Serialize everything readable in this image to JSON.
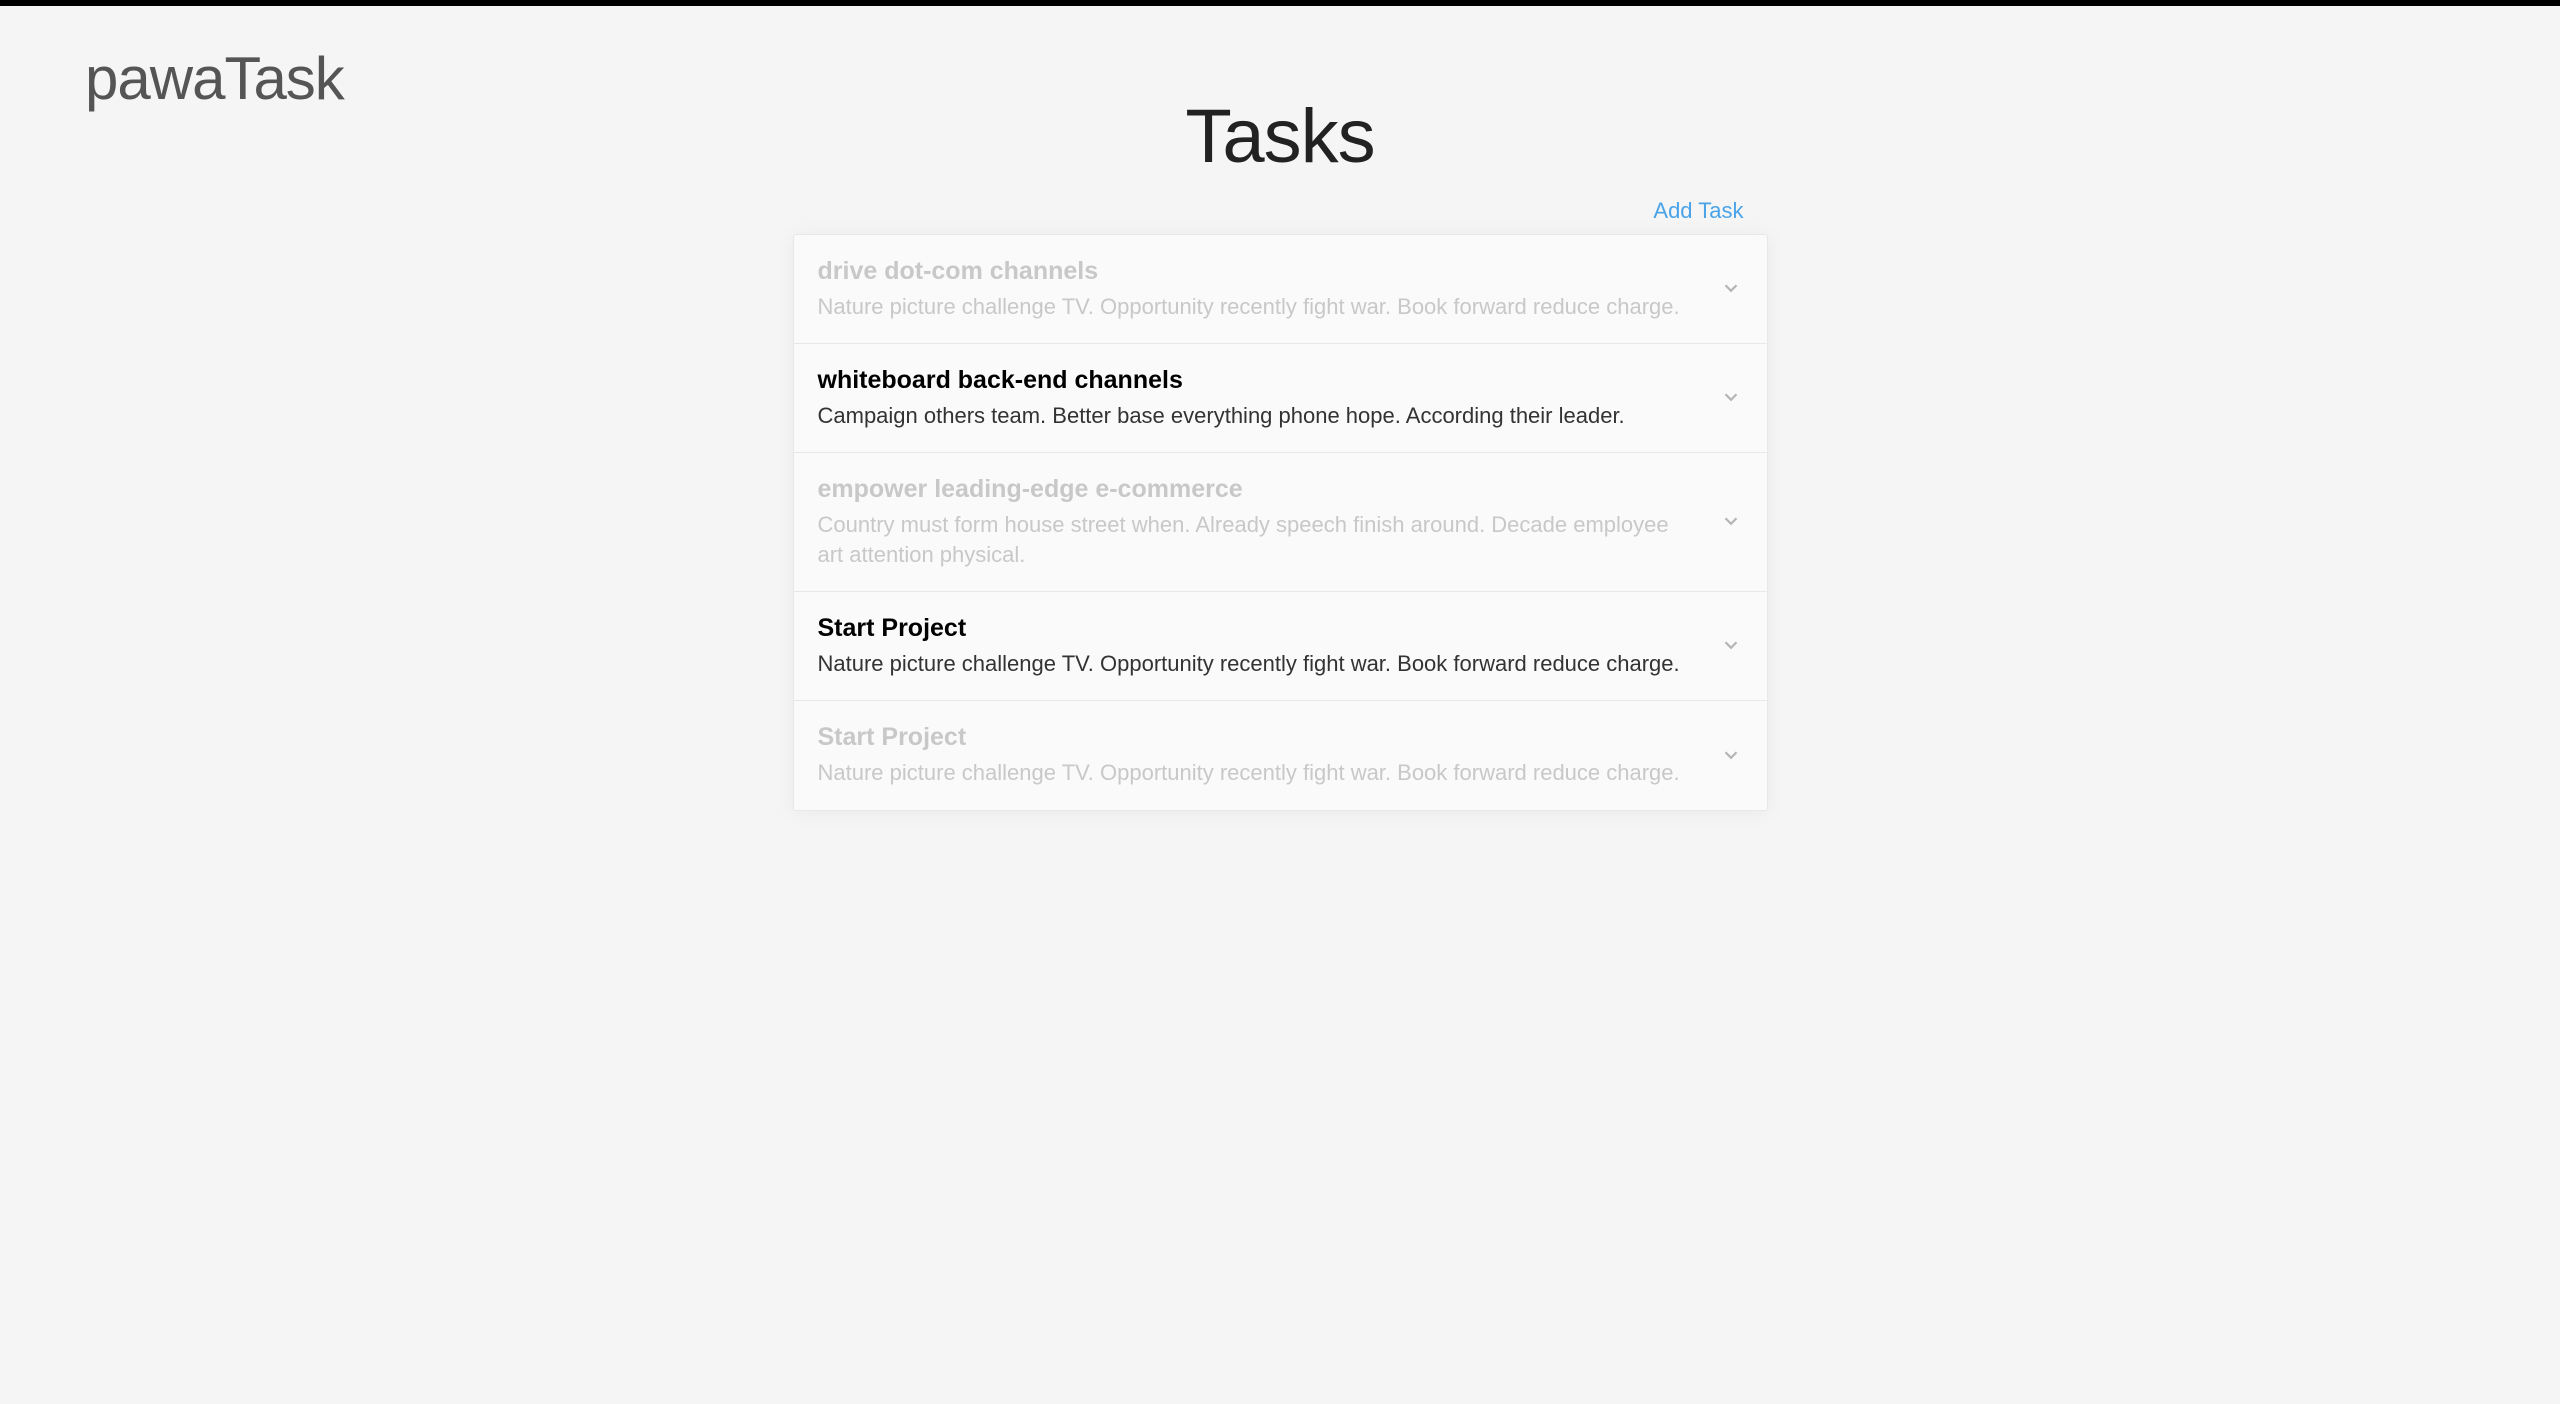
{
  "app": {
    "title": "pawaTask"
  },
  "page": {
    "heading": "Tasks",
    "add_label": "Add Task"
  },
  "tasks": [
    {
      "title": "drive dot-com channels",
      "description": "Nature picture challenge TV. Opportunity recently fight war. Book forward reduce charge.",
      "dimmed": true
    },
    {
      "title": "whiteboard back-end channels",
      "description": "Campaign others team. Better base everything phone hope. According their leader.",
      "dimmed": false
    },
    {
      "title": "empower leading-edge e-commerce",
      "description": "Country must form house street when. Already speech finish around. Decade employee art attention physical.",
      "dimmed": true
    },
    {
      "title": "Start Project",
      "description": "Nature picture challenge TV. Opportunity recently fight war. Book forward reduce charge.",
      "dimmed": false
    },
    {
      "title": "Start Project",
      "description": "Nature picture challenge TV. Opportunity recently fight war. Book forward reduce charge.",
      "dimmed": true
    }
  ]
}
